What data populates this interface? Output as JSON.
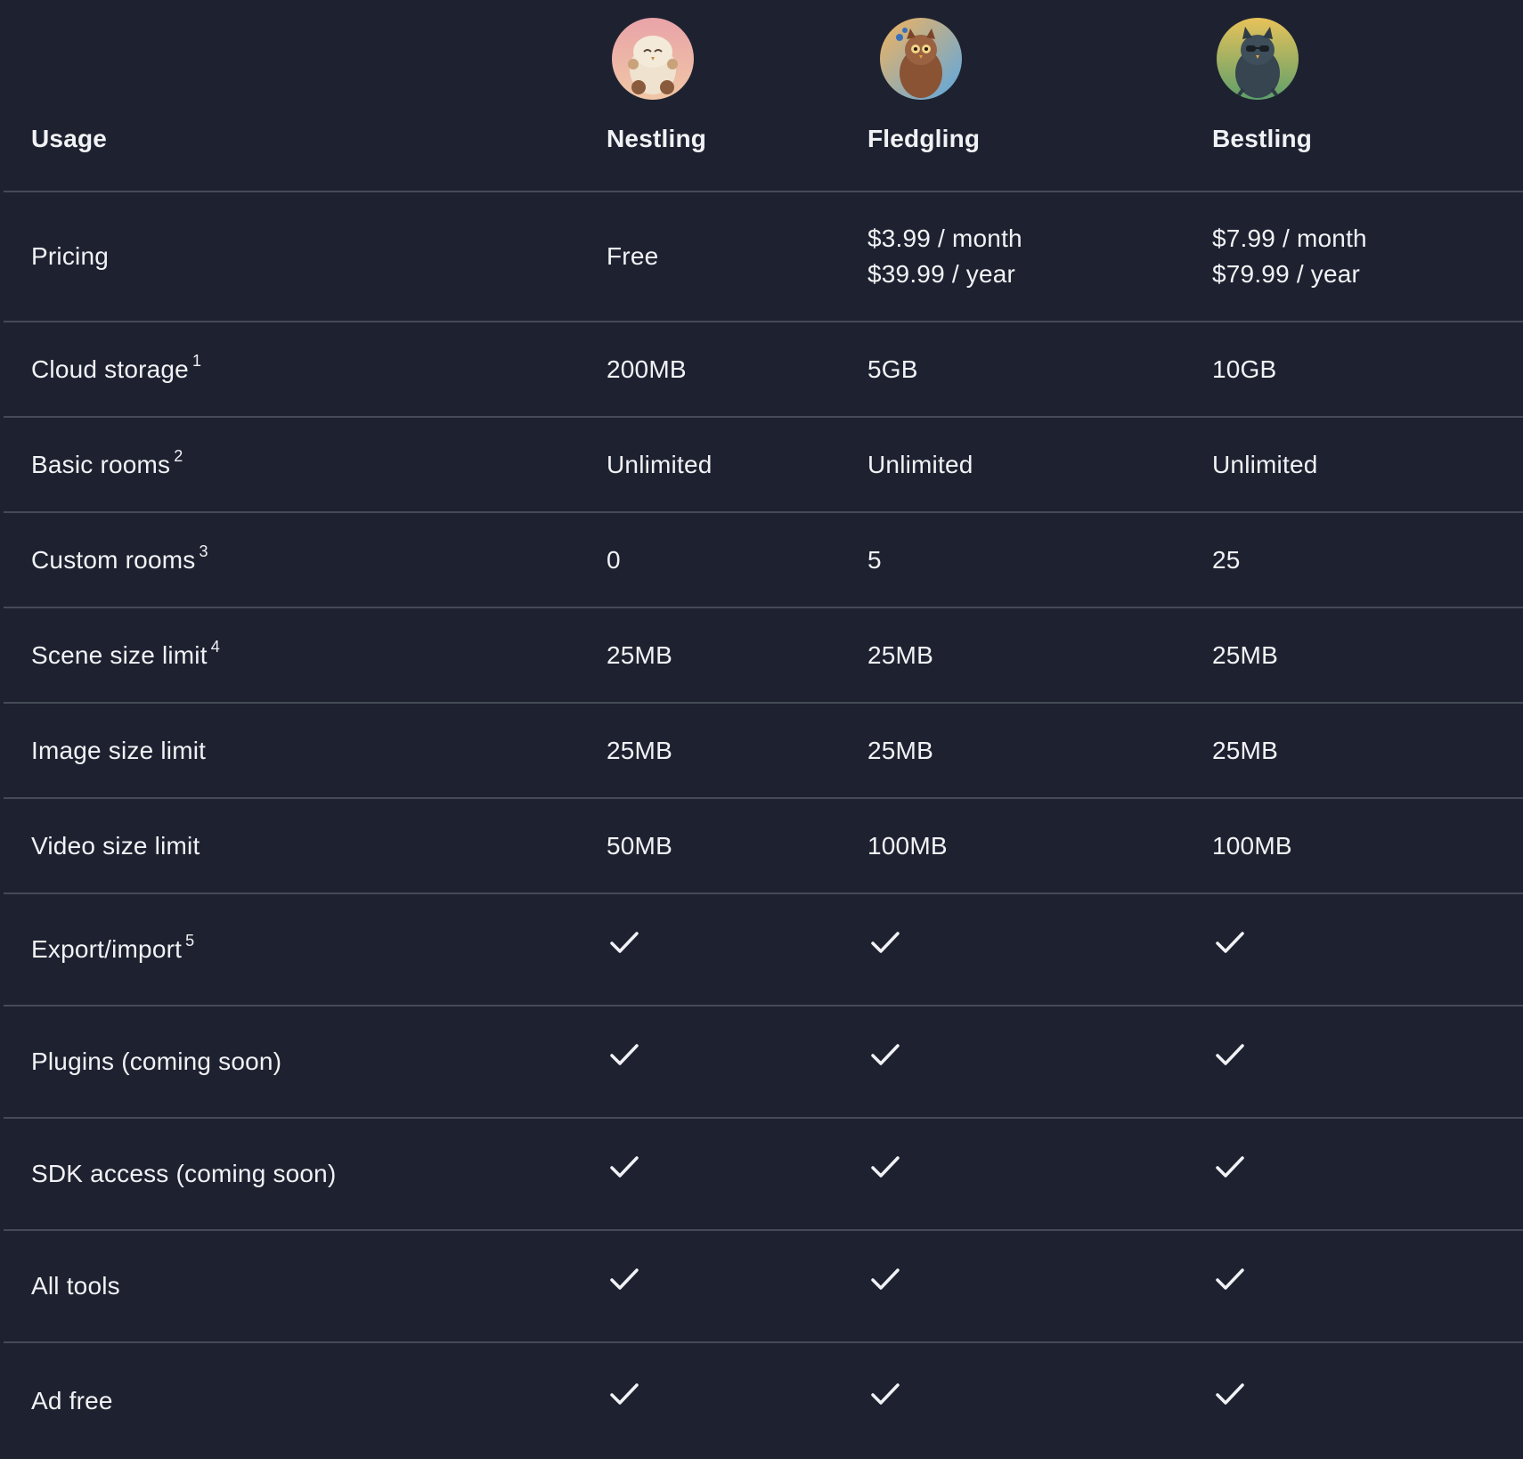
{
  "header": {
    "usage_label": "Usage",
    "tiers": [
      {
        "name": "Nestling",
        "avatar_icon": "owl-nestling-avatar",
        "avatar_colors": [
          "#e9a3a8",
          "#f0c7a6"
        ]
      },
      {
        "name": "Fledgling",
        "avatar_icon": "owl-fledgling-avatar",
        "avatar_colors": [
          "#f3b35c",
          "#5aa7e3"
        ]
      },
      {
        "name": "Bestling",
        "avatar_icon": "owl-bestling-avatar",
        "avatar_colors": [
          "#e8c25a",
          "#5d9f6a"
        ]
      }
    ]
  },
  "rows": {
    "pricing": {
      "label": "Pricing",
      "nestling": "Free",
      "fledgling_month": "$3.99 / month",
      "fledgling_year": "$39.99 / year",
      "bestling_month": "$7.99 / month",
      "bestling_year": "$79.99 / year"
    },
    "cloud_storage": {
      "label": "Cloud storage",
      "footnote": "1",
      "values": [
        "200MB",
        "5GB",
        "10GB"
      ]
    },
    "basic_rooms": {
      "label": "Basic rooms",
      "footnote": "2",
      "values": [
        "Unlimited",
        "Unlimited",
        "Unlimited"
      ]
    },
    "custom_rooms": {
      "label": "Custom rooms",
      "footnote": "3",
      "values": [
        "0",
        "5",
        "25"
      ]
    },
    "scene_size": {
      "label": "Scene size limit",
      "footnote": "4",
      "values": [
        "25MB",
        "25MB",
        "25MB"
      ]
    },
    "image_size": {
      "label": "Image size limit",
      "values": [
        "25MB",
        "25MB",
        "25MB"
      ]
    },
    "video_size": {
      "label": "Video size limit",
      "values": [
        "50MB",
        "100MB",
        "100MB"
      ]
    },
    "export_import": {
      "label": "Export/import",
      "footnote": "5",
      "icon": "checkmark-icon"
    },
    "plugins": {
      "label": "Plugins (coming soon)",
      "icon": "checkmark-icon"
    },
    "sdk": {
      "label": "SDK access (coming soon)",
      "icon": "checkmark-icon"
    },
    "all_tools": {
      "label": "All tools",
      "icon": "checkmark-icon"
    },
    "ad_free": {
      "label": "Ad free",
      "icon": "checkmark-icon"
    }
  },
  "colors": {
    "background": "#1e2230",
    "divider": "#454a57",
    "text": "#f1f2f5"
  }
}
